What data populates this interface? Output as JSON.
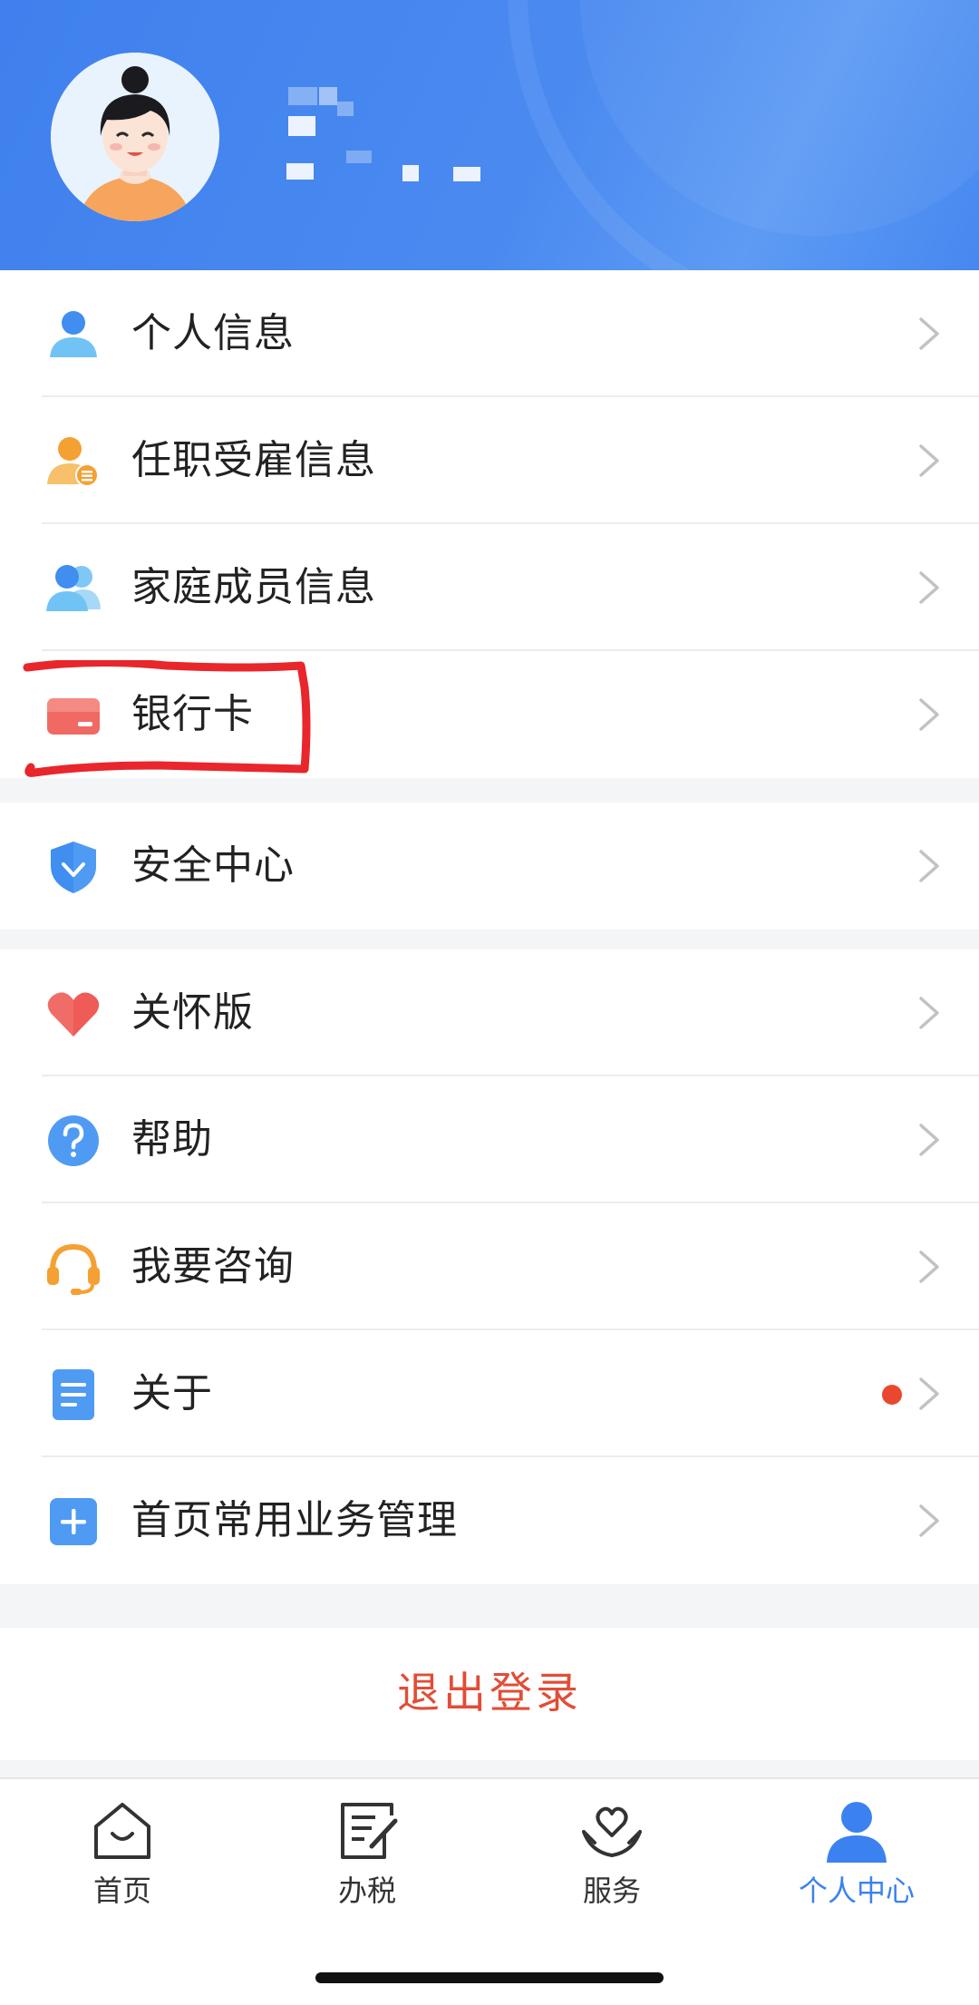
{
  "header": {
    "avatar_name": "user-avatar",
    "username_blurred": ""
  },
  "menu_group_1": [
    {
      "label": "个人信息",
      "icon": "person-icon"
    },
    {
      "label": "任职受雇信息",
      "icon": "employment-icon"
    },
    {
      "label": "家庭成员信息",
      "icon": "family-icon"
    },
    {
      "label": "银行卡",
      "icon": "bank-card-icon"
    }
  ],
  "menu_group_2": [
    {
      "label": "安全中心",
      "icon": "shield-icon"
    }
  ],
  "menu_group_3": [
    {
      "label": "关怀版",
      "icon": "heart-icon"
    },
    {
      "label": "帮助",
      "icon": "help-icon"
    },
    {
      "label": "我要咨询",
      "icon": "headset-icon"
    },
    {
      "label": "关于",
      "icon": "document-icon",
      "has_new_badge": true
    },
    {
      "label": "首页常用业务管理",
      "icon": "plus-square-icon"
    }
  ],
  "logout_label": "退出登录",
  "tabbar": {
    "tabs": [
      {
        "label": "首页",
        "icon": "home-icon",
        "active": false
      },
      {
        "label": "办税",
        "icon": "tax-form-icon",
        "active": false
      },
      {
        "label": "服务",
        "icon": "service-heart-icon",
        "active": false
      },
      {
        "label": "个人中心",
        "icon": "user-icon",
        "active": true
      }
    ]
  },
  "colors": {
    "header_blue": "#4385ef",
    "accent_blue": "#3b82f0",
    "logout_red": "#e14d36",
    "badge_red": "#e9482f",
    "annotation_red": "#e8262c"
  }
}
